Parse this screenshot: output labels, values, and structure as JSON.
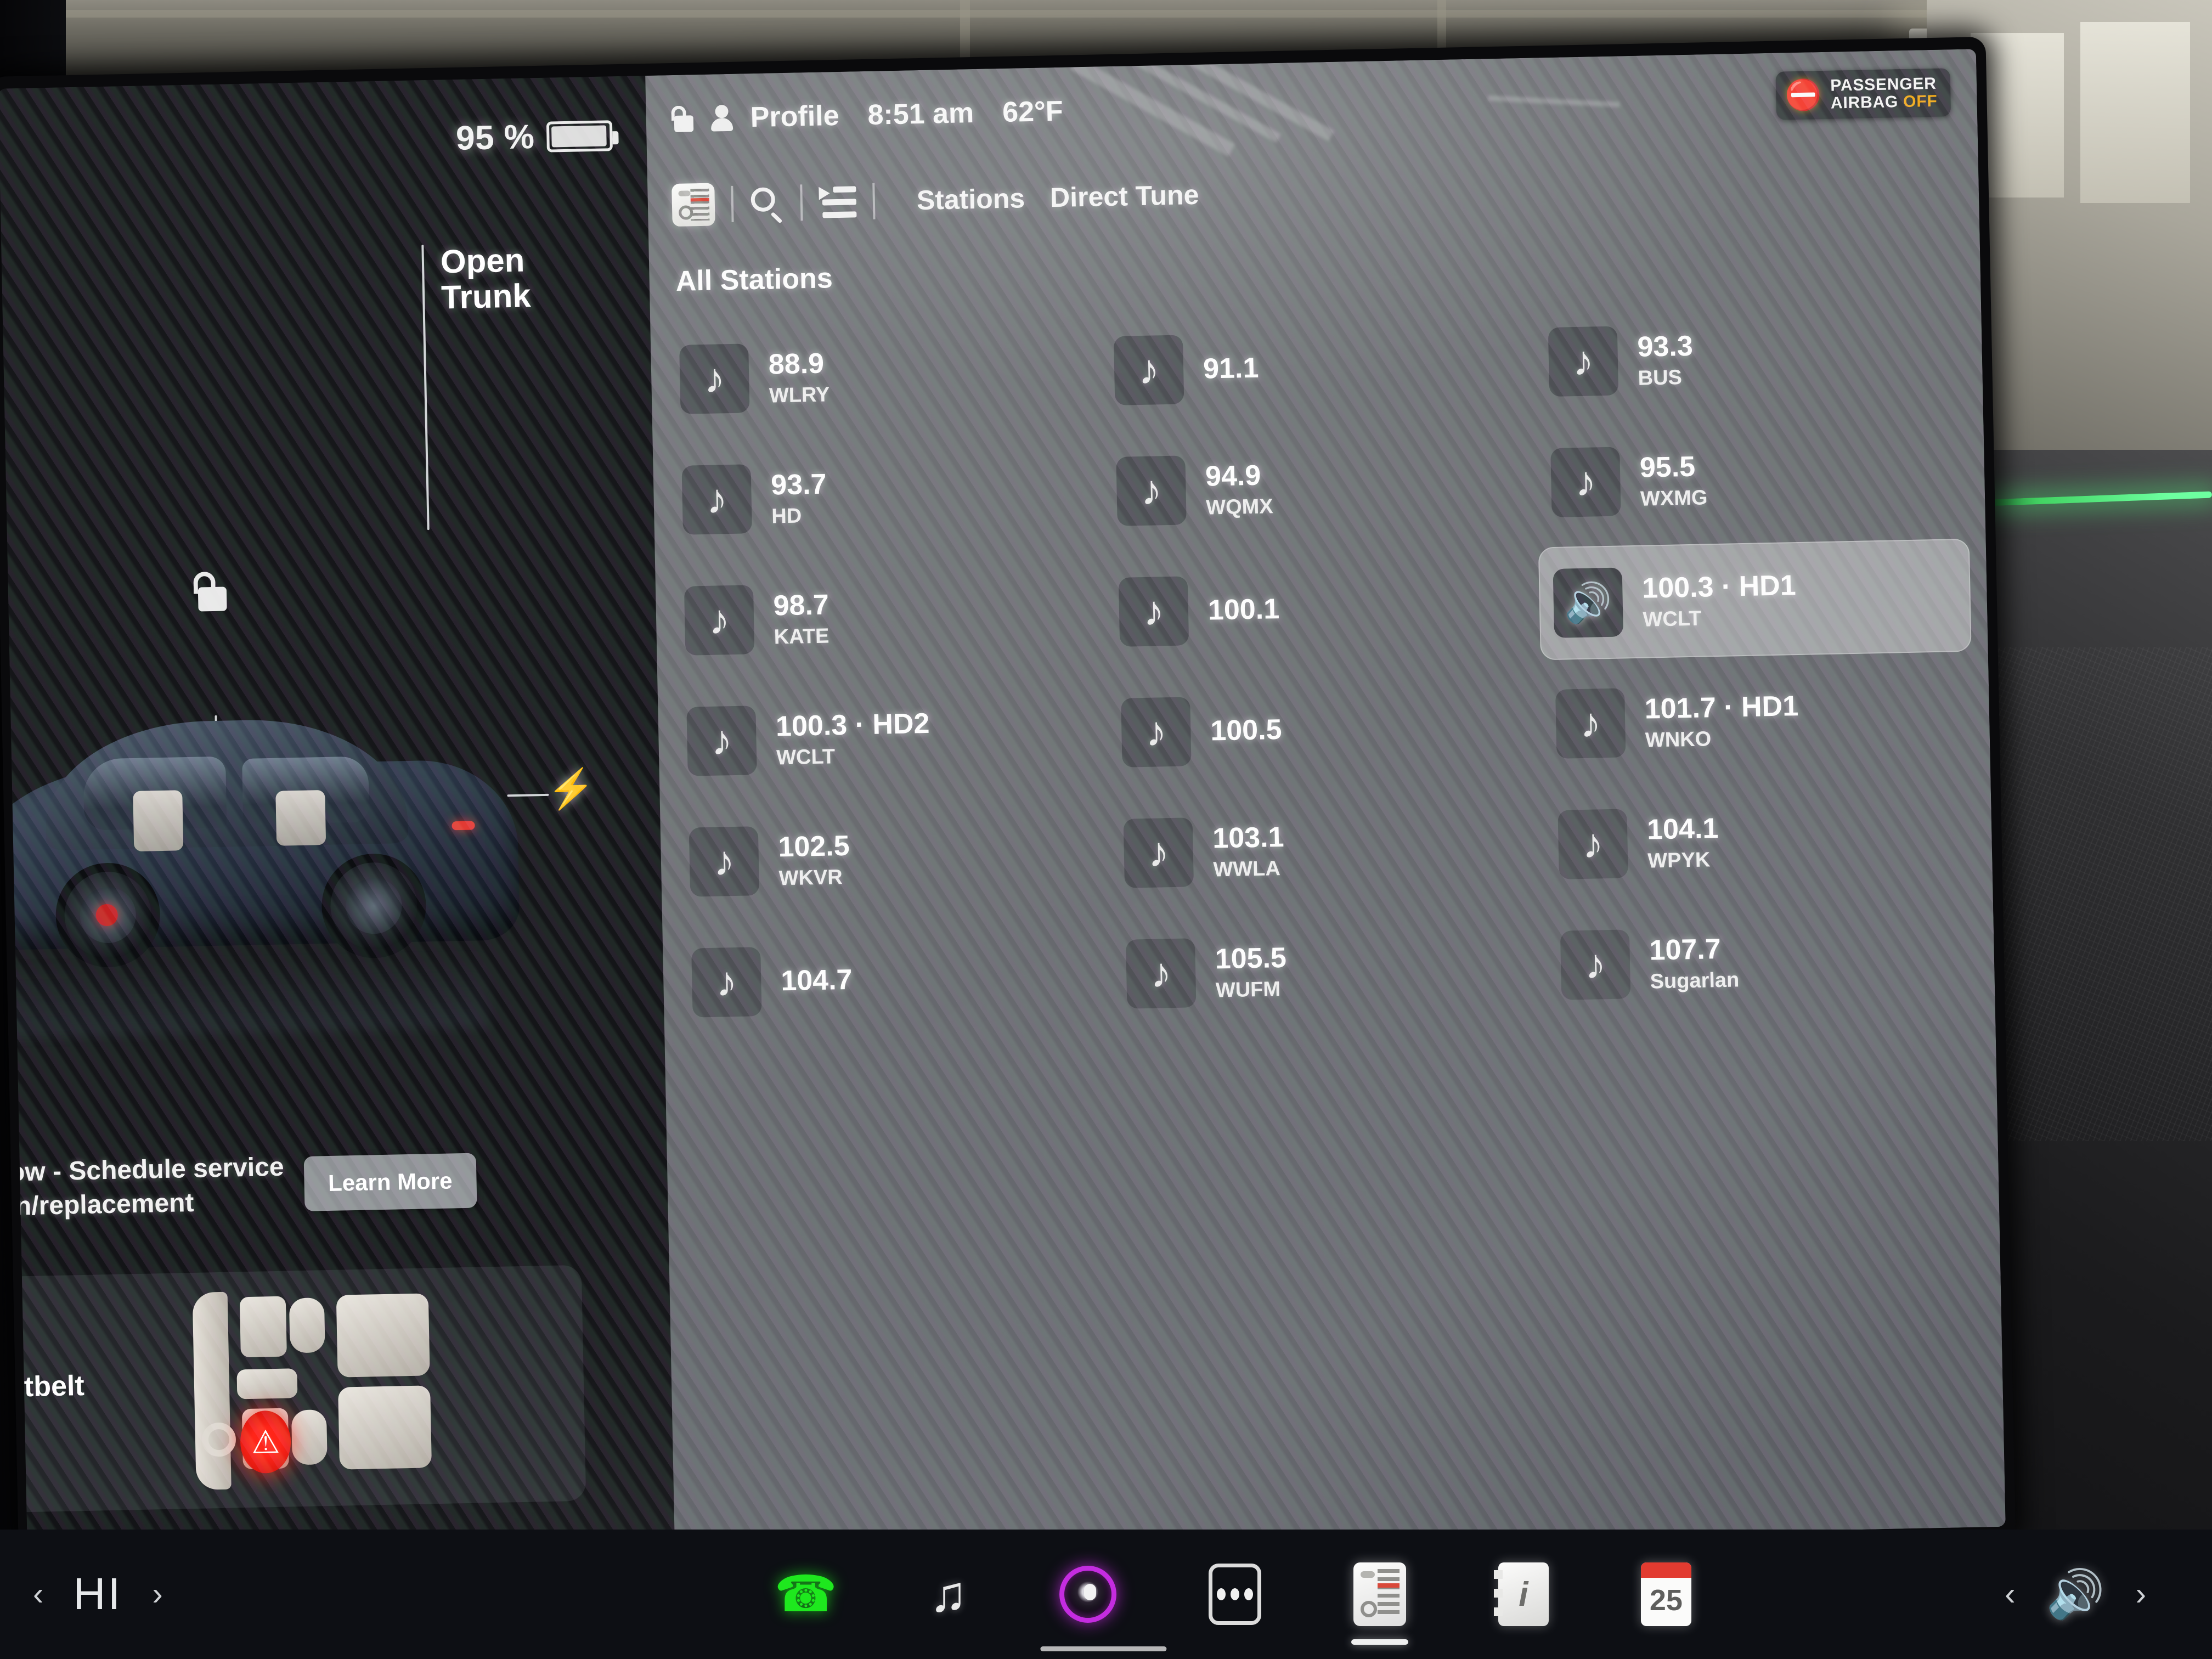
{
  "vehicle": {
    "battery_percent": "95 %",
    "callouts": [
      {
        "name": "open-trunk",
        "label": "Open\nTrunk"
      }
    ],
    "lock_state_icon": "unlock-icon",
    "charge_port_icon": "lightning-bolt-icon",
    "service_alert": {
      "line1": "d depth low - Schedule service",
      "line2": "or rotation/replacement",
      "button": "Learn More"
    },
    "seatbelt_alert": {
      "label": "tbelt",
      "warning_icon": "seatbelt-unfastened-icon",
      "warning_color": "#ff2418"
    }
  },
  "statusbar": {
    "lock_icon": "lock-icon",
    "profile_icon": "person-icon",
    "profile": "Profile",
    "time": "8:51 am",
    "temperature": "62°F",
    "airbag_badge": {
      "line1": "PASSENGER",
      "line2_a": "AIRBAG ",
      "line2_b": "OFF",
      "icon": "passenger-airbag-off-icon",
      "accent": "#f0a91c"
    }
  },
  "radio": {
    "app_icon": "radio-tuner-icon",
    "search_icon": "search-icon",
    "queue_icon": "playlist-queue-icon",
    "tabs": [
      {
        "label": "Stations",
        "active": true
      },
      {
        "label": "Direct Tune",
        "active": false
      }
    ],
    "section_title": "All Stations",
    "columns": [
      {
        "stations": [
          {
            "freq": "88.9",
            "call": "WLRY",
            "active": false,
            "icon": "music-note-icon"
          },
          {
            "freq": "93.7",
            "call": "HD",
            "active": false,
            "icon": "music-note-icon"
          },
          {
            "freq": "98.7",
            "call": "KATE",
            "active": false,
            "icon": "music-note-icon"
          },
          {
            "freq": "100.3 · HD2",
            "call": "WCLT",
            "active": false,
            "icon": "music-note-icon"
          },
          {
            "freq": "102.5",
            "call": "WKVR",
            "active": false,
            "icon": "music-note-icon"
          },
          {
            "freq": "104.7",
            "call": "",
            "active": false,
            "icon": "music-note-icon"
          }
        ]
      },
      {
        "stations": [
          {
            "freq": "91.1",
            "call": "",
            "active": false,
            "icon": "music-note-icon"
          },
          {
            "freq": "94.9",
            "call": "WQMX",
            "active": false,
            "icon": "music-note-icon"
          },
          {
            "freq": "100.1",
            "call": "",
            "active": false,
            "icon": "music-note-icon"
          },
          {
            "freq": "100.5",
            "call": "",
            "active": false,
            "icon": "music-note-icon"
          },
          {
            "freq": "103.1",
            "call": "WWLA",
            "active": false,
            "icon": "music-note-icon"
          },
          {
            "freq": "105.5",
            "call": "WUFM",
            "active": false,
            "icon": "music-note-icon"
          }
        ]
      },
      {
        "stations": [
          {
            "freq": "93.3",
            "call": "BUS",
            "active": false,
            "icon": "music-note-icon"
          },
          {
            "freq": "95.5",
            "call": "WXMG",
            "active": false,
            "icon": "music-note-icon"
          },
          {
            "freq": "100.3 · HD1",
            "call": "WCLT",
            "active": true,
            "icon": "speaker-playing-icon"
          },
          {
            "freq": "101.7 · HD1",
            "call": "WNKO",
            "active": false,
            "icon": "music-note-icon"
          },
          {
            "freq": "104.1",
            "call": "WPYK",
            "active": false,
            "icon": "music-note-icon"
          },
          {
            "freq": "107.7",
            "call": "Sugarlan",
            "active": false,
            "icon": "music-note-icon"
          }
        ]
      }
    ]
  },
  "taskbar": {
    "climate_prev": "‹",
    "climate_temp": "HI",
    "climate_next": "›",
    "phone_icon": "phone-icon",
    "media_icon": "music-note-icon",
    "voice_icon": "voice-assistant-icon",
    "apps_icon": "apps-grid-icon",
    "tuner_icon": "radio-tuner-icon",
    "manual_icon": "owners-manual-icon",
    "calendar_icon": "calendar-icon",
    "calendar_day": "25",
    "volume_prev": "‹",
    "volume_icon": "volume-icon",
    "volume_next": "›",
    "phone_color": "#1ee81e",
    "voice_color": "#c42ce0"
  }
}
